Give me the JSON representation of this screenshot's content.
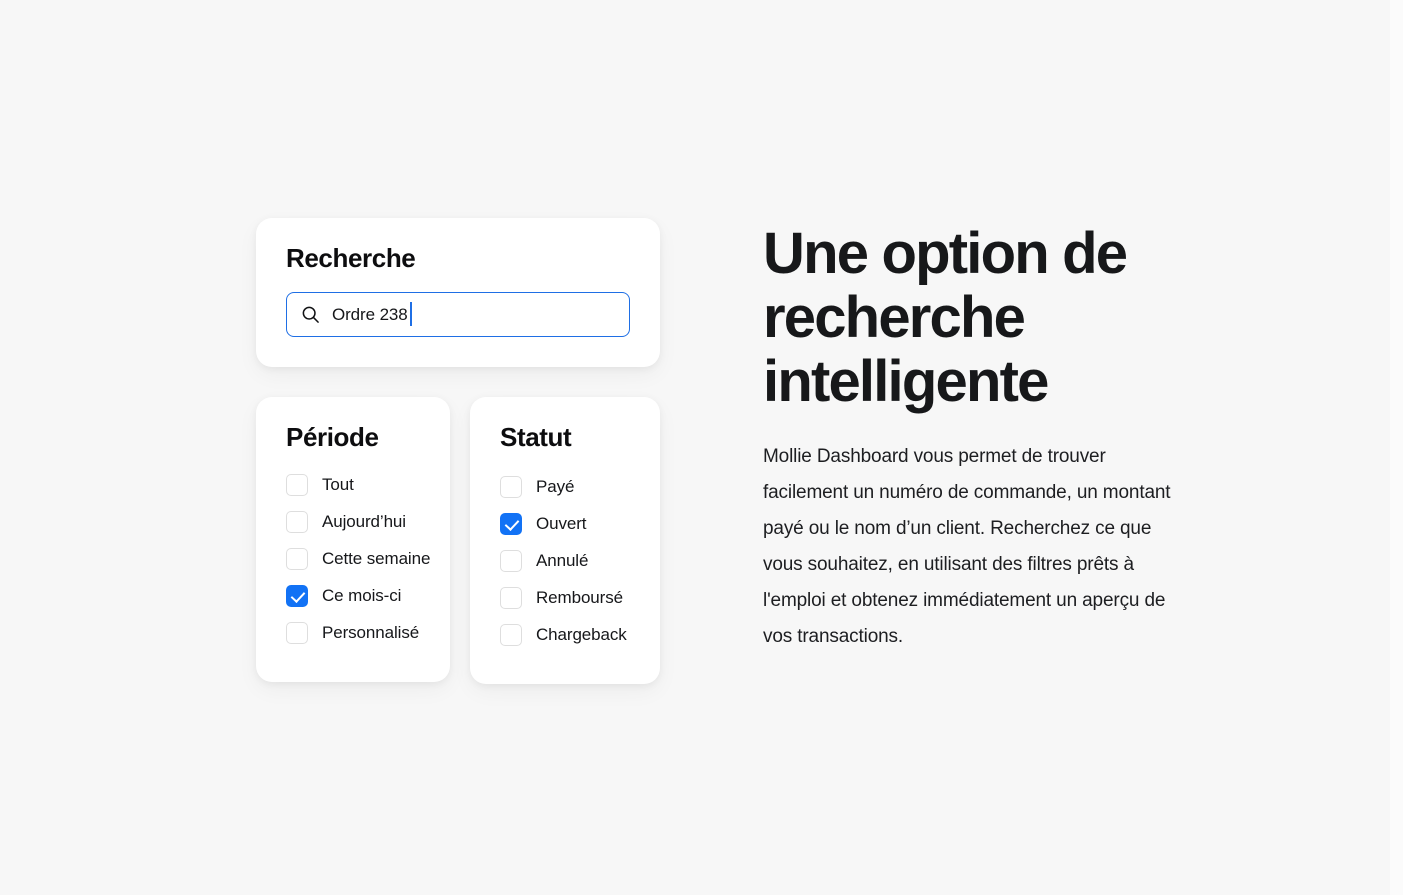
{
  "theme": {
    "background": "#f7f7f7",
    "card_background": "#ffffff",
    "accent_blue": "#1272f5",
    "focus_blue": "#1f6fe5",
    "text_primary": "#16171a",
    "checkbox_border": "#dedede"
  },
  "search_card": {
    "title": "Recherche",
    "icon": "search-icon",
    "input_value": "Ordre 238",
    "placeholder": "Ordre 238",
    "focused": true,
    "caret_visible": true
  },
  "periode_card": {
    "title": "Période",
    "options": [
      {
        "label": "Tout",
        "checked": false
      },
      {
        "label": "Aujourd’hui",
        "checked": false
      },
      {
        "label": "Cette semaine",
        "checked": false
      },
      {
        "label": "Ce mois-ci",
        "checked": true
      },
      {
        "label": "Personnalisé",
        "checked": false
      }
    ]
  },
  "statut_card": {
    "title": "Statut",
    "options": [
      {
        "label": "Payé",
        "checked": false
      },
      {
        "label": "Ouvert",
        "checked": true
      },
      {
        "label": "Annulé",
        "checked": false
      },
      {
        "label": "Remboursé",
        "checked": false
      },
      {
        "label": "Chargeback",
        "checked": false
      }
    ]
  },
  "content": {
    "headline": "Une option de recherche intelligente",
    "paragraph": "Mollie Dashboard vous permet de trouver facilement un numéro de commande, un montant payé ou le nom d’un client. Recherchez ce que vous souhaitez, en utilisant des filtres prêts à l'emploi et obtenez immédiatement un aperçu de vos transactions."
  }
}
